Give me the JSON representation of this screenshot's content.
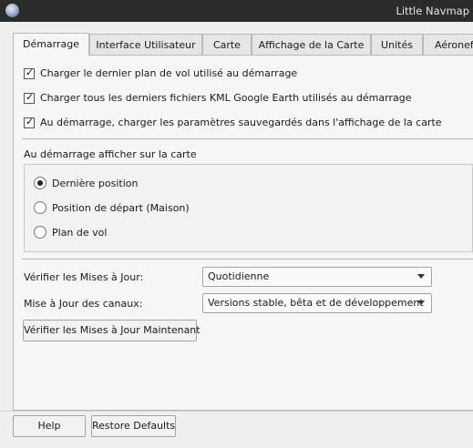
{
  "window": {
    "title": "Little Navmap",
    "app_icon": "globe-icon"
  },
  "tabs": [
    {
      "label": "Démarrage",
      "active": true
    },
    {
      "label": "Interface Utilisateur",
      "active": false
    },
    {
      "label": "Carte",
      "active": false
    },
    {
      "label": "Affichage de la Carte",
      "active": false
    },
    {
      "label": "Unités",
      "active": false
    },
    {
      "label": "Aéronef",
      "active": false
    }
  ],
  "startup": {
    "options": [
      {
        "label": "Charger le dernier plan de vol utilisé au démarrage",
        "checked": true
      },
      {
        "label": "Charger tous les derniers fichiers KML Google Earth utilisés au démarrage",
        "checked": true
      },
      {
        "label": "Au démarrage, charger les paramètres sauvegardés dans l'affichage de la carte",
        "checked": true
      }
    ],
    "map_group_title": "Au démarrage afficher sur la carte",
    "map_choices": [
      {
        "label": "Dernière position",
        "selected": true
      },
      {
        "label": "Position de départ (Maison)",
        "selected": false
      },
      {
        "label": "Plan de vol",
        "selected": false
      }
    ]
  },
  "updates": {
    "check_label": "Vérifier les Mises à Jour:",
    "check_value": "Quotidienne",
    "channel_label": "Mise à Jour des canaux:",
    "channel_value": "Versions stable, bêta et de développement",
    "check_now_label": "Vérifier les Mises à Jour Maintenant"
  },
  "footer": {
    "help_label": "Help",
    "restore_label": "Restore Defaults"
  }
}
